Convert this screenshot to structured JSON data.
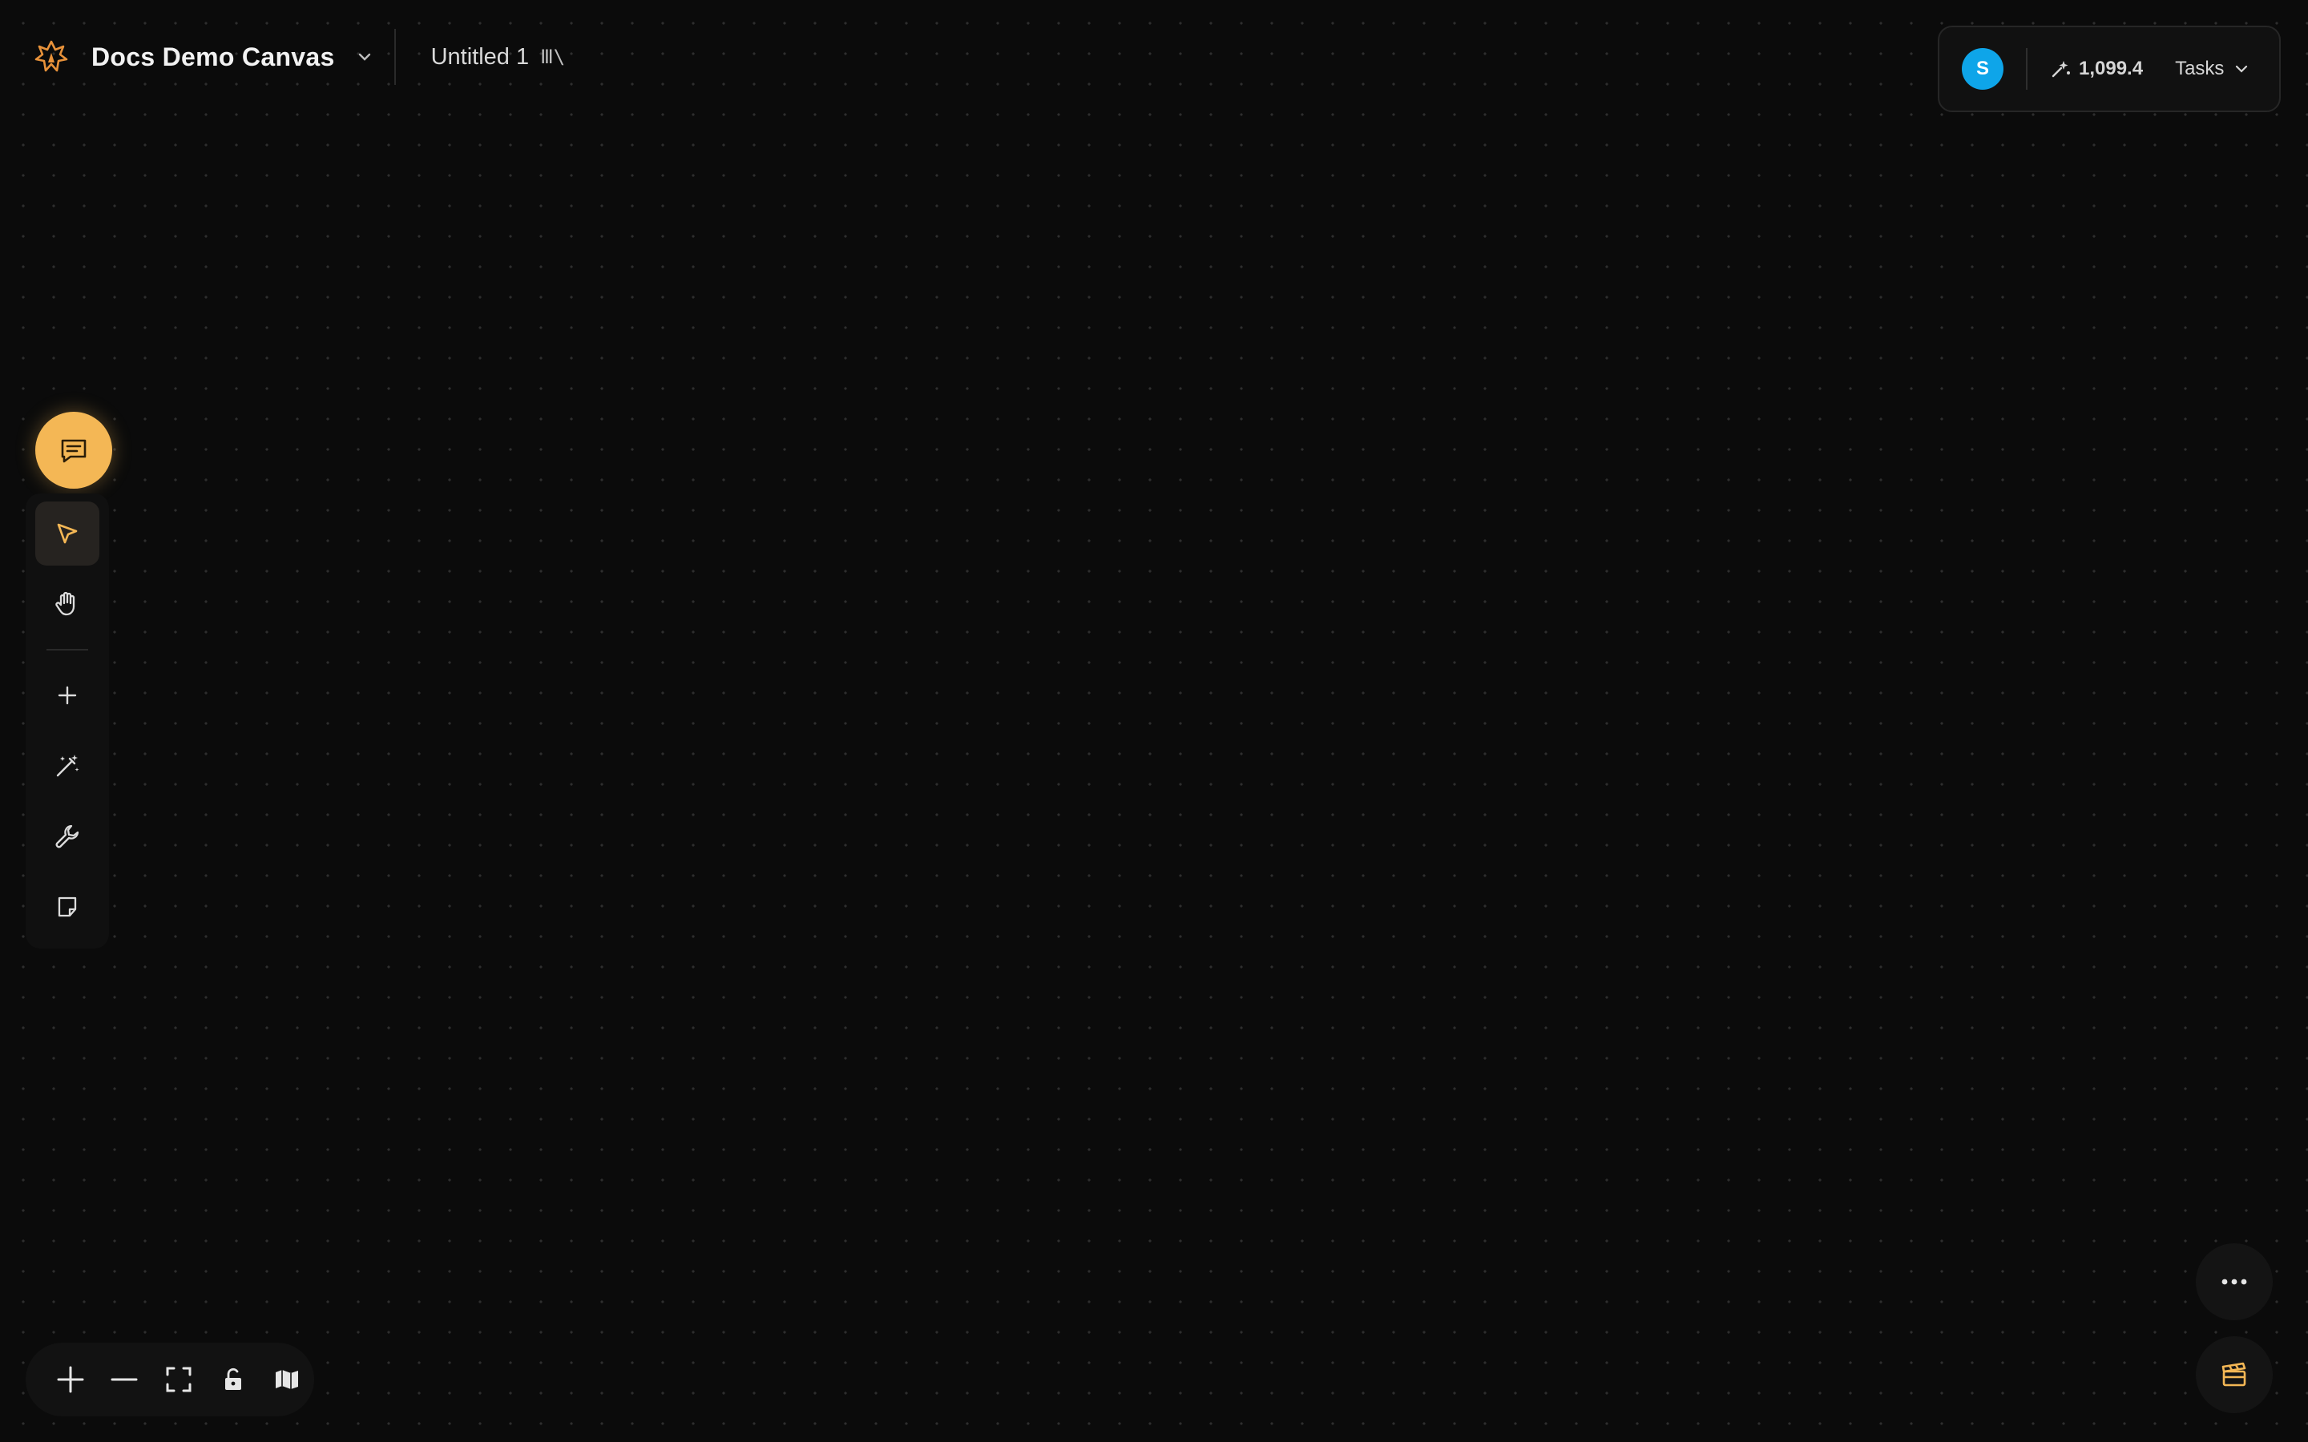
{
  "header": {
    "project_name": "Docs Demo Canvas",
    "doc_title": "Untitled 1",
    "doc_title_icon": "library-icon",
    "doc_title_glyph": "Ⅲ\\"
  },
  "account": {
    "avatar_initial": "S",
    "avatar_color": "#0ea5e9",
    "credits": "1,099.4",
    "tasks_label": "Tasks"
  },
  "toolbar": {
    "chat": "chat-icon",
    "tools": [
      "select-pointer-icon",
      "hand-pan-icon",
      "plus-icon",
      "magic-wand-icon",
      "wrench-icon",
      "note-icon"
    ],
    "active_tool": "select-pointer-icon"
  },
  "zoom_controls": [
    "zoom-in-icon",
    "zoom-out-icon",
    "fit-screen-icon",
    "lock-icon",
    "map-icon"
  ],
  "colors": {
    "accent": "#f4b755",
    "background": "#0b0b0b"
  }
}
